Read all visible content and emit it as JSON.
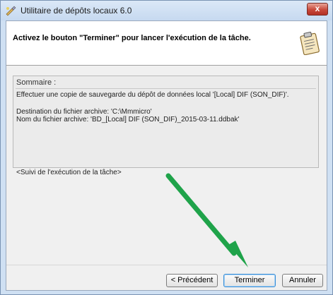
{
  "window": {
    "title": "Utilitaire de dépôts locaux 6.0",
    "close_label": "x"
  },
  "header": {
    "instruction": "Activez le bouton \"Terminer\" pour lancer l'exécution de la tâche."
  },
  "summary": {
    "title": "Sommaire :",
    "lines": [
      "Effectuer une copie de sauvegarde du dépôt de données local '[Local] DIF (SON_DIF)'.",
      "",
      "Destination du fichier archive: 'C:\\Mmmicro'",
      "Nom du fichier archive: 'BD_[Local] DIF (SON_DIF)_2015-03-11.ddbak'"
    ]
  },
  "progress": {
    "label": "<Suivi de l'exécution de la tâche>"
  },
  "buttons": {
    "previous": "< Précédent",
    "finish": "Terminer",
    "cancel": "Annuler"
  },
  "annotation": {
    "arrow_color": "#1fa34a"
  }
}
